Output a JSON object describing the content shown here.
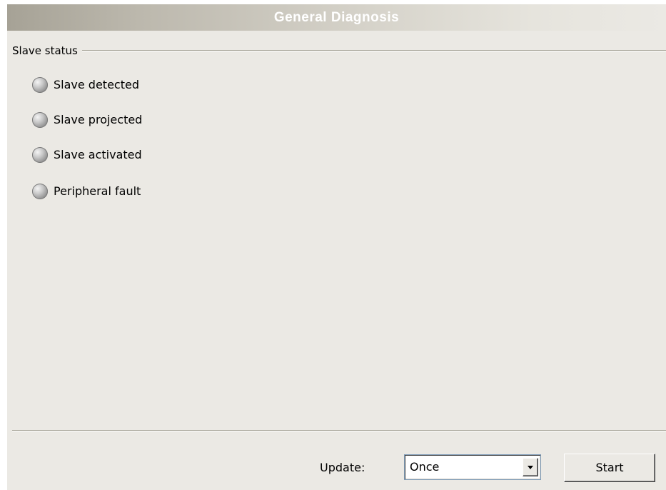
{
  "header": {
    "title": "General Diagnosis"
  },
  "slave_status": {
    "group_label": "Slave status",
    "items": [
      {
        "label": "Slave detected",
        "indicator": "gray-led-icon",
        "state": "off"
      },
      {
        "label": "Slave projected",
        "indicator": "gray-led-icon",
        "state": "off"
      },
      {
        "label": "Slave activated",
        "indicator": "gray-led-icon",
        "state": "off"
      },
      {
        "label": "Peripheral fault",
        "indicator": "gray-led-icon",
        "state": "off"
      }
    ]
  },
  "footer": {
    "update_label": "Update:",
    "update_value": "Once",
    "start_label": "Start"
  },
  "colors": {
    "panel_background": "#ebe9e4",
    "title_text": "#ffffff",
    "led_off": "#a0a0a0"
  }
}
